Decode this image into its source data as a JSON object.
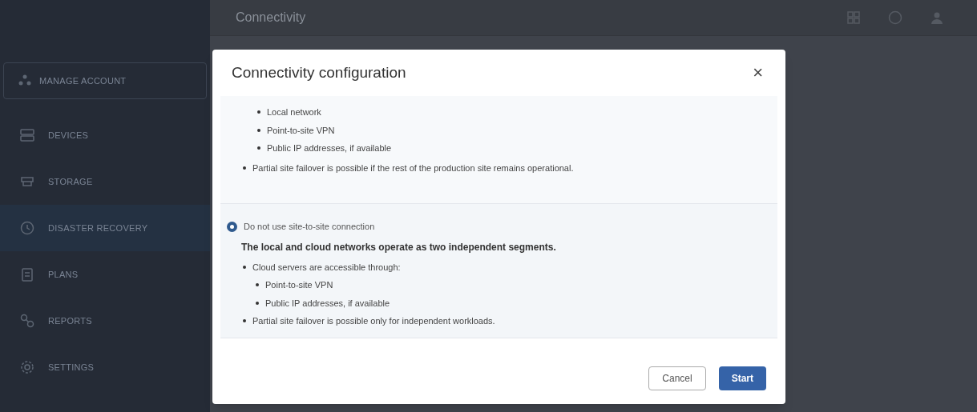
{
  "header": {
    "title": "Connectivity"
  },
  "sidebar": {
    "account": "MANAGE ACCOUNT",
    "items": [
      {
        "label": "DEVICES",
        "kind": "devices",
        "selected": false
      },
      {
        "label": "STORAGE",
        "kind": "storage",
        "selected": false
      },
      {
        "label": "DISASTER RECOVERY",
        "kind": "recovery",
        "selected": true
      },
      {
        "label": "PLANS",
        "kind": "plans",
        "selected": false
      },
      {
        "label": "REPORTS",
        "kind": "link",
        "selected": false
      },
      {
        "label": "SETTINGS",
        "kind": "gear",
        "selected": false
      }
    ]
  },
  "dialog": {
    "title": "Connectivity configuration",
    "close": "×",
    "options": [
      {
        "selected": false,
        "items": [
          {
            "text": "Local network"
          },
          {
            "text": "Point-to-site VPN"
          },
          {
            "text": "Public IP addresses, if available"
          }
        ],
        "after": [
          {
            "text": "Partial site failover is possible if the rest of the production site remains operational."
          }
        ]
      },
      {
        "selected": true,
        "label": "Do not use site-to-site connection",
        "summary": "The local and cloud networks operate as two independent segments.",
        "items": [
          {
            "text": "Cloud servers are accessible through:",
            "children": [
              {
                "text": "Point-to-site VPN"
              },
              {
                "text": "Public IP addresses, if available"
              }
            ]
          },
          {
            "text": "Partial site failover is possible only for independent workloads."
          }
        ]
      }
    ],
    "buttons": [
      {
        "label": "Cancel",
        "kind": "secondary"
      },
      {
        "label": "Start",
        "kind": "primary"
      }
    ]
  }
}
